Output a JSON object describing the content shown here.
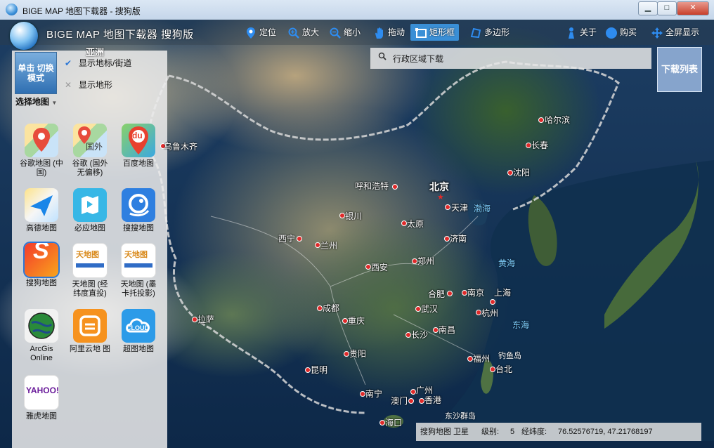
{
  "window": {
    "title": "BIGE MAP 地图下载器 - 搜狗版",
    "btn_min": "▁",
    "btn_max": "□",
    "btn_close": "✕"
  },
  "header": {
    "app_title": "BIGE MAP 地图下载器 搜狗版",
    "tools": [
      {
        "label": "定位",
        "icon": "location-pin-icon"
      },
      {
        "label": "放大",
        "icon": "zoom-in-icon"
      },
      {
        "label": "缩小",
        "icon": "zoom-out-icon"
      },
      {
        "label": "拖动",
        "icon": "hand-icon"
      },
      {
        "label": "矩形框",
        "icon": "rectangle-select-icon",
        "active": true
      },
      {
        "label": "多边形",
        "icon": "polygon-icon"
      },
      {
        "label": "关于",
        "icon": "about-icon"
      },
      {
        "label": "购买",
        "icon": "buy-icon"
      },
      {
        "label": "全屏显示",
        "icon": "fullscreen-icon"
      }
    ]
  },
  "left_panel": {
    "switch_mode": "单击 切换模式",
    "select_map": "选择地图",
    "show_markers": "显示地标/街道",
    "show_terrain": "显示地形",
    "maps": [
      {
        "label": "谷歌地图 (中国)",
        "icon": "google-maps-icon"
      },
      {
        "label": "谷歌 (国外 无偏移)",
        "icon": "google-maps-foreign-icon",
        "badge": "国外"
      },
      {
        "label": "百度地图",
        "icon": "baidu-map-icon",
        "badge": "du"
      },
      {
        "label": "高德地图",
        "icon": "amap-icon"
      },
      {
        "label": "必应地图",
        "icon": "bing-map-icon"
      },
      {
        "label": "搜搜地图",
        "icon": "soso-map-icon"
      },
      {
        "label": "搜狗地图",
        "icon": "sogou-map-icon",
        "selected": true,
        "badge": "S"
      },
      {
        "label": "天地图 (经 纬度直投)",
        "icon": "tianditu-icon",
        "badge": "天地图"
      },
      {
        "label": "天地图 (墨 卡托投影)",
        "icon": "tianditu-mercator-icon",
        "badge": "天地图"
      },
      {
        "label": "ArcGis Online",
        "icon": "arcgis-globe-icon"
      },
      {
        "label": "阿里云地 图",
        "icon": "aliyun-map-icon"
      },
      {
        "label": "超图地图",
        "icon": "supermap-cloud-icon",
        "badge": "CLOUD"
      },
      {
        "label": "雅虎地图",
        "icon": "yahoo-maps-icon",
        "badge": "YAHOO!"
      }
    ]
  },
  "search": {
    "label": "行政区域下载"
  },
  "download_list": "下载列表",
  "map": {
    "continent_label": "亚洲",
    "capital": "北京",
    "cities": [
      "乌鲁木齐",
      "哈尔滨",
      "长春",
      "沈阳",
      "呼和浩特",
      "天津",
      "银川",
      "太原",
      "西宁",
      "兰州",
      "济南",
      "西安",
      "郑州",
      "合肥",
      "南京",
      "上海",
      "成都",
      "武汉",
      "杭州",
      "拉萨",
      "重庆",
      "长沙",
      "南昌",
      "贵阳",
      "福州",
      "台北",
      "昆明",
      "南宁",
      "广州",
      "澳门",
      "香港",
      "海口"
    ],
    "seas": [
      "渤海",
      "黄海",
      "东海",
      "钓鱼岛",
      "东沙群岛"
    ]
  },
  "status": {
    "map_name": "搜狗地图 卫星",
    "level_label": "级别:",
    "level": "5",
    "coord_label": "经纬度:",
    "coords": "76.52576719, 47.21768197"
  }
}
